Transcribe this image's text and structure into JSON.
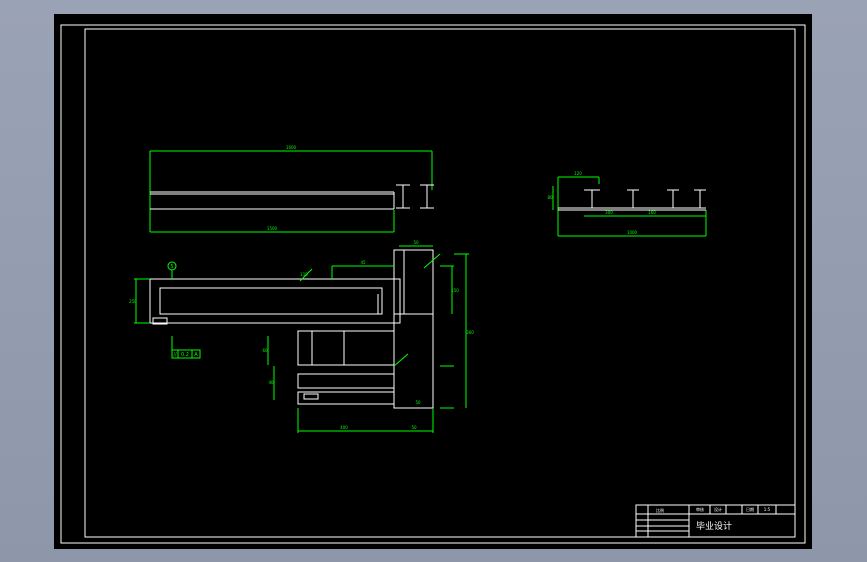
{
  "viewport": {
    "background": "#959eb1"
  },
  "drawing": {
    "paper_color": "#000000",
    "frame_color": "#ffffff",
    "geometry_color": "#ffffff",
    "dimension_color": "#00ff00",
    "title_block": {
      "title": "毕业设计",
      "label_r1": "比例",
      "label_r2": "审核",
      "label_r3": "设计",
      "label_r4": "日期",
      "scale": "1:5"
    },
    "front_view": {
      "overall_dim": "1600",
      "base_dim": "1500"
    },
    "side_view": {
      "top_dim": "120",
      "seg_dim_1": "300",
      "seg_dim_2": "160",
      "overall_dim": "1000",
      "height_dim": "80"
    },
    "plan_view": {
      "balloon": "5",
      "tolerance": "0.2",
      "datum": "A",
      "dim_h1": "45",
      "dim_h2": "50",
      "dim_v1": "60",
      "dim_right": "360",
      "dim_right2": "150",
      "dim_left": "250",
      "dim_bottom": "400",
      "dim_bottom2": "50",
      "dim_mid": "110",
      "dim_small": "40"
    }
  }
}
